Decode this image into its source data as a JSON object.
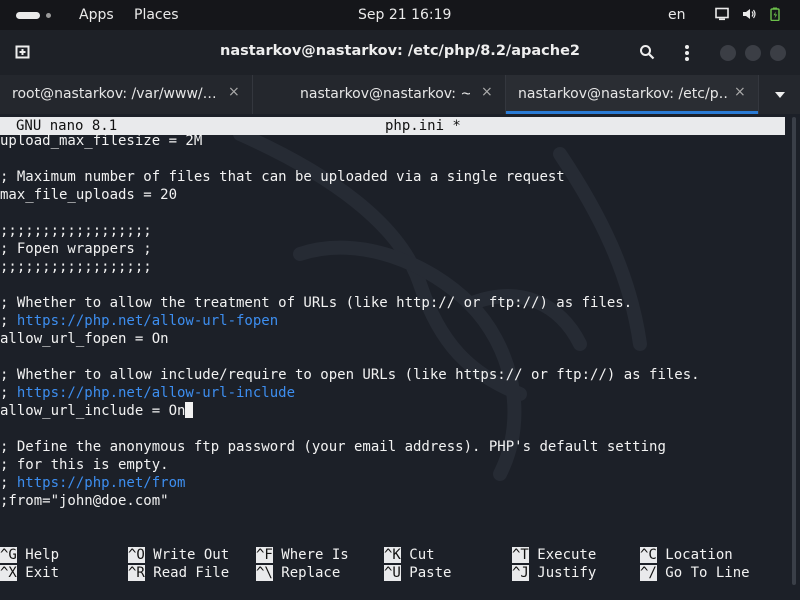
{
  "topbar": {
    "apps": "Apps",
    "places": "Places",
    "datetime": "Sep 21  16:19",
    "lang": "en"
  },
  "window": {
    "title": "nastarkov@nastarkov: /etc/php/8.2/apache2"
  },
  "tabs": [
    {
      "label": "root@nastarkov: /var/www/…",
      "close": "×"
    },
    {
      "label": "nastarkov@nastarkov: ~",
      "close": "×"
    },
    {
      "label": "nastarkov@nastarkov: /etc/p…",
      "close": "×"
    }
  ],
  "nano": {
    "version": "GNU nano 8.1",
    "filename": "php.ini *",
    "lines": [
      {
        "text": "upload_max_filesize = 2M"
      },
      {
        "text": ""
      },
      {
        "text": "; Maximum number of files that can be uploaded via a single request"
      },
      {
        "text": "max_file_uploads = 20"
      },
      {
        "text": ""
      },
      {
        "text": ";;;;;;;;;;;;;;;;;;"
      },
      {
        "text": "; Fopen wrappers ;"
      },
      {
        "text": ";;;;;;;;;;;;;;;;;;"
      },
      {
        "text": ""
      },
      {
        "text": "; Whether to allow the treatment of URLs (like http:// or ftp://) as files."
      },
      {
        "prefix": "; ",
        "url": "https://php.net/allow-url-fopen"
      },
      {
        "text": "allow_url_fopen = On"
      },
      {
        "text": ""
      },
      {
        "text": "; Whether to allow include/require to open URLs (like https:// or ftp://) as files."
      },
      {
        "prefix": "; ",
        "url": "https://php.net/allow-url-include"
      },
      {
        "text": "allow_url_include = On",
        "cursor": true
      },
      {
        "text": ""
      },
      {
        "text": "; Define the anonymous ftp password (your email address). PHP's default setting"
      },
      {
        "text": "; for this is empty."
      },
      {
        "prefix": "; ",
        "url": "https://php.net/from"
      },
      {
        "text": ";from=\"john@doe.com\""
      }
    ],
    "shortcuts": [
      {
        "key": "^G",
        "label": "Help"
      },
      {
        "key": "^O",
        "label": "Write Out"
      },
      {
        "key": "^F",
        "label": "Where Is"
      },
      {
        "key": "^K",
        "label": "Cut"
      },
      {
        "key": "^T",
        "label": "Execute"
      },
      {
        "key": "^C",
        "label": "Location"
      },
      {
        "key": "^X",
        "label": "Exit"
      },
      {
        "key": "^R",
        "label": "Read File"
      },
      {
        "key": "^\\",
        "label": "Replace"
      },
      {
        "key": "^U",
        "label": "Paste"
      },
      {
        "key": "^J",
        "label": "Justify"
      },
      {
        "key": "^/",
        "label": "Go To Line"
      }
    ]
  },
  "icons": {
    "new_tab": "new-tab-icon",
    "search": "search-icon",
    "menu": "kebab-menu-icon",
    "display": "display-icon",
    "volume": "volume-icon",
    "battery": "battery-icon"
  },
  "colors": {
    "terminal_bg": "#1c2028",
    "url": "#3d8ef0",
    "active_tab_underline": "#2a7bd5"
  }
}
